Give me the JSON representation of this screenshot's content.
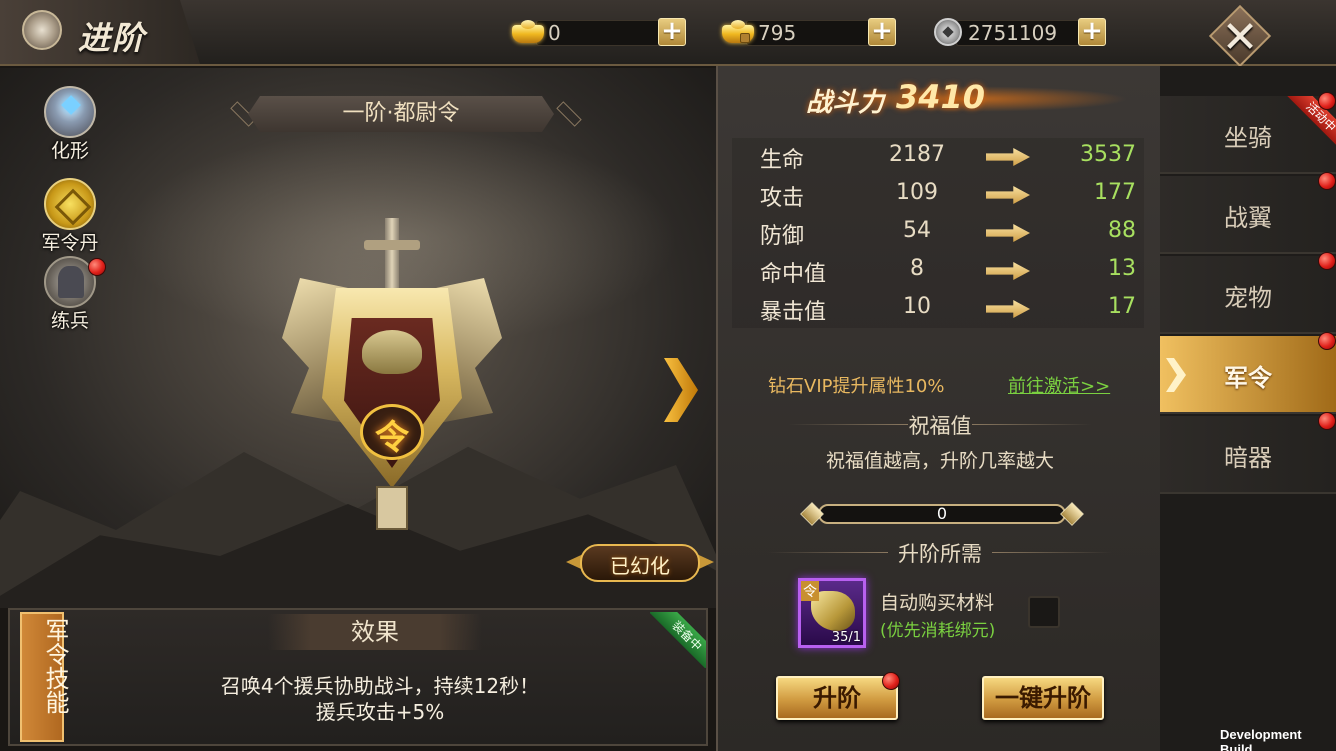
{
  "header": {
    "title": "进阶",
    "currencies": [
      {
        "icon": "gold-ingot-icon",
        "value": "0"
      },
      {
        "icon": "bound-gold-ingot-icon",
        "value": "795"
      },
      {
        "icon": "silver-coin-icon",
        "value": "2751109"
      }
    ],
    "plus_label": "+",
    "close_label": "✕"
  },
  "left_menu": [
    {
      "label": "化形"
    },
    {
      "label": "军令丹"
    },
    {
      "label": "练兵"
    }
  ],
  "stage": {
    "rank_name": "一阶·都尉令",
    "emblem_char": "令",
    "transformed_badge": "已幻化"
  },
  "skill": {
    "tag": "军令技能",
    "effect_title": "效果",
    "equipped_ribbon": "装备中",
    "desc_line1": "召唤4个援兵协助战斗，持续12秒！",
    "desc_line2": "援兵攻击+5%"
  },
  "stats": {
    "power_label": "战斗力",
    "power_value": "3410",
    "rows": [
      {
        "name": "生命",
        "current": "2187",
        "next": "3537"
      },
      {
        "name": "攻击",
        "current": "109",
        "next": "177"
      },
      {
        "name": "防御",
        "current": "54",
        "next": "88"
      },
      {
        "name": "命中值",
        "current": "8",
        "next": "13"
      },
      {
        "name": "暴击值",
        "current": "10",
        "next": "17"
      }
    ],
    "vip_text": "钻石VIP提升属性10%",
    "vip_link": "前往激活>>",
    "bless_title": "祝福值",
    "bless_desc": "祝福值越高，升阶几率越大",
    "bless_value": "0",
    "bless_fraction": 0,
    "requirements_title": "升阶所需",
    "material_tag": "令",
    "material_count": "35/1",
    "auto_buy_label": "自动购买材料",
    "auto_buy_sub": "(优先消耗绑元)",
    "upgrade_button": "升阶",
    "one_click_button": "一键升阶"
  },
  "tabs": [
    {
      "label": "坐骑",
      "event": "活动中"
    },
    {
      "label": "战翼"
    },
    {
      "label": "宠物"
    },
    {
      "label": "军令",
      "active": true
    },
    {
      "label": "暗器"
    }
  ],
  "footer": {
    "build_label": "Development Build"
  },
  "colors": {
    "accent_gold": "#f0c060",
    "stat_increase": "#a8e060",
    "link_green": "#7ad040",
    "notification_red": "#e0201a"
  }
}
